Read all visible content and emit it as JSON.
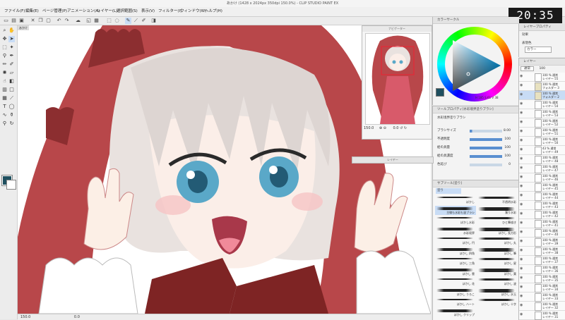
{
  "window": {
    "title": "あかけ (1428 x 2024px 350dpi 150.0%)  - CLIP STUDIO PAINT EX"
  },
  "clock": "20:35",
  "menu": [
    "ファイル(F)",
    "編集(E)",
    "ページ管理(P)",
    "アニメーション(A)",
    "レイヤー(L)",
    "選択範囲(S)",
    "表示(V)",
    "フィルター(I)",
    "ウィンドウ(W)",
    "ヘルプ(H)"
  ],
  "canvas": {
    "tab": "あかけ",
    "zoom": "150.0",
    "status": "0.0"
  },
  "navigator": {
    "title": "ナビゲーター",
    "zoom": "150.0",
    "angle": "0.0"
  },
  "bottom_panel_title": "レイヤー",
  "color_panel": {
    "title": "カラーサークル",
    "fg_color": "#1f4f5f",
    "h": "H",
    "s": "S",
    "v": "V",
    "values": [
      "185",
      "61",
      "38"
    ]
  },
  "tool_property": {
    "title": "ツールプロパティ[水彩境界塗りブラシ]",
    "brush_name": "水彩境界塗りブラシ",
    "rows": [
      {
        "label": "ブラシサイズ",
        "value": "8.00",
        "fill": 0.08
      },
      {
        "label": "不透明度",
        "value": "100",
        "fill": 1
      },
      {
        "label": "絵の具量",
        "value": "100",
        "fill": 1
      },
      {
        "label": "絵の具濃度",
        "value": "100",
        "fill": 1
      },
      {
        "label": "色延び",
        "value": "0",
        "fill": 0
      }
    ]
  },
  "sub_tool": {
    "title": "サブツール[塗り]",
    "group": "塗り",
    "brushes": [
      "ぼかし",
      "不透明水彩",
      "主線も水彩も塗ブラシ",
      "濁り水彩",
      "ぼかし水彩",
      "ひと筆描き",
      "水彩境界",
      "ぼかし 長方形",
      "ぼかし 円",
      "ぼかし 丸",
      "ぼかし 四角",
      "ぼかし 筆",
      "ぼかし 三角",
      "ぼかし 星",
      "ぼかし 雲",
      "ぼかし 葉",
      "ぼかし 花",
      "ぼかし 波",
      "ぼかし うろこ",
      "ぼかし 水玉",
      "ぼかし ハート",
      "ぼかし 十字",
      "ぼかし クリップ"
    ]
  },
  "layer_property": {
    "title": "レイヤープロパティ",
    "effect": "効果",
    "expression": "表現色",
    "expression_value": "カラー"
  },
  "layers": {
    "title": "レイヤー",
    "blend": "通常",
    "opacity": "100",
    "items": [
      {
        "name": "レイヤー 55",
        "mode": "100 % 通常",
        "kind": "layer"
      },
      {
        "name": "フォルダー 3",
        "mode": "100 % 通常",
        "kind": "folder"
      },
      {
        "name": "フォルダー 2",
        "mode": "100 % 通常",
        "kind": "folder",
        "selected": true
      },
      {
        "name": "レイヤー 54",
        "mode": "100 % 通常",
        "kind": "layer"
      },
      {
        "name": "レイヤー 53",
        "mode": "100 % 通常",
        "kind": "layer"
      },
      {
        "name": "レイヤー 52",
        "mode": "100 % 通常",
        "kind": "layer"
      },
      {
        "name": "レイヤー 51",
        "mode": "100 % 通常",
        "kind": "layer"
      },
      {
        "name": "レイヤー 50",
        "mode": "100 % 通常",
        "kind": "layer"
      },
      {
        "name": "レイヤー 49",
        "mode": "43 % 通常",
        "kind": "layer"
      },
      {
        "name": "レイヤー 48",
        "mode": "100 % 通常",
        "kind": "layer"
      },
      {
        "name": "レイヤー 47",
        "mode": "100 % 通常",
        "kind": "layer"
      },
      {
        "name": "レイヤー 46",
        "mode": "100 % 通常",
        "kind": "layer"
      },
      {
        "name": "レイヤー 45",
        "mode": "100 % 通常",
        "kind": "layer"
      },
      {
        "name": "レイヤー 44",
        "mode": "100 % 通常",
        "kind": "layer"
      },
      {
        "name": "レイヤー 43",
        "mode": "100 % 通常",
        "kind": "layer"
      },
      {
        "name": "レイヤー 42",
        "mode": "100 % 通常",
        "kind": "layer"
      },
      {
        "name": "レイヤー 41",
        "mode": "100 % 通常",
        "kind": "layer"
      },
      {
        "name": "レイヤー 40",
        "mode": "100 % 通常",
        "kind": "layer"
      },
      {
        "name": "レイヤー 39",
        "mode": "100 % 通常",
        "kind": "layer"
      },
      {
        "name": "レイヤー 38",
        "mode": "100 % 通常",
        "kind": "layer"
      },
      {
        "name": "レイヤー 37",
        "mode": "100 % 通常",
        "kind": "layer"
      },
      {
        "name": "レイヤー 36",
        "mode": "100 % 通常",
        "kind": "layer"
      },
      {
        "name": "レイヤー 35",
        "mode": "100 % 通常",
        "kind": "layer"
      },
      {
        "name": "レイヤー 34",
        "mode": "100 % 通常",
        "kind": "layer"
      },
      {
        "name": "レイヤー 33",
        "mode": "100 % 通常",
        "kind": "layer"
      },
      {
        "name": "レイヤー 32",
        "mode": "100 % 通常",
        "kind": "layer"
      },
      {
        "name": "レイヤー 31",
        "mode": "100 % 通常",
        "kind": "layer"
      }
    ]
  },
  "colors": {
    "hood_red": "#b8474a",
    "hair": "#e9e2df",
    "eye_blue": "#5aa8c8",
    "ribbon": "#7e2424"
  }
}
